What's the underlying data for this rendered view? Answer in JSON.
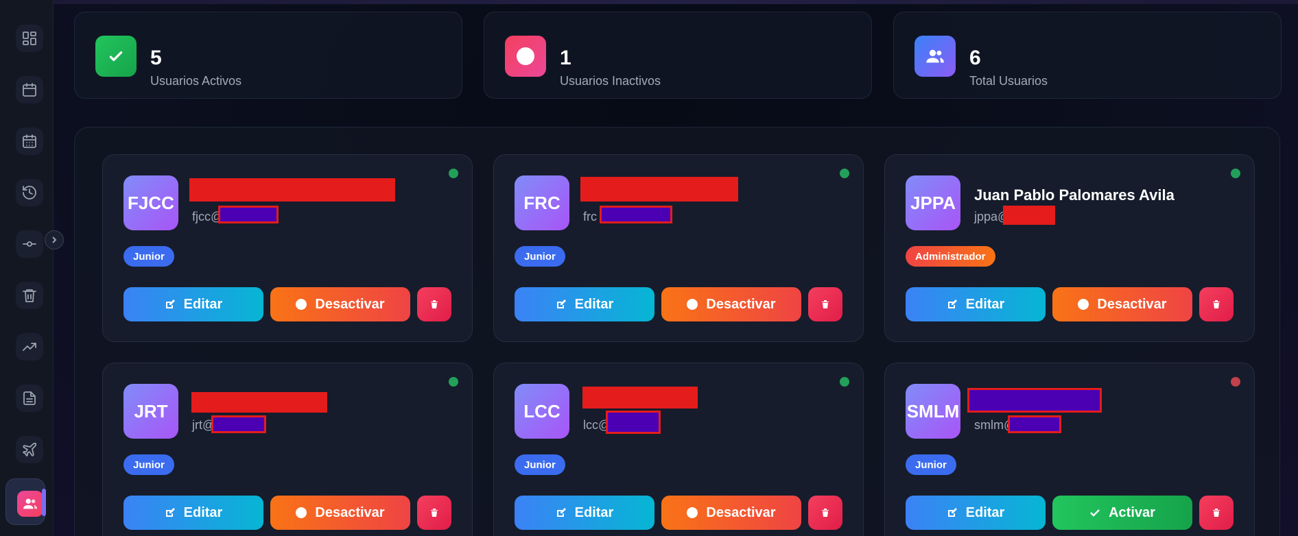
{
  "sidebar": {
    "items": [
      {
        "icon": "dashboard-icon"
      },
      {
        "icon": "calendar-icon"
      },
      {
        "icon": "calendar-grid-icon"
      },
      {
        "icon": "history-icon"
      },
      {
        "icon": "git-commit-icon"
      },
      {
        "icon": "trash-icon"
      },
      {
        "icon": "trending-up-icon"
      },
      {
        "icon": "document-icon"
      },
      {
        "icon": "plane-icon"
      }
    ],
    "active_icon": "users-icon"
  },
  "stats": [
    {
      "value": "5",
      "label": "Usuarios Activos",
      "icon": "check-icon",
      "color": "#22c55e"
    },
    {
      "value": "1",
      "label": "Usuarios Inactivos",
      "icon": "circle-icon",
      "color": "#f43f5e"
    },
    {
      "value": "6",
      "label": "Total Usuarios",
      "icon": "users-icon",
      "color": "#6366f1"
    }
  ],
  "actions": {
    "edit": "Editar",
    "deactivate": "Desactivar",
    "activate": "Activar"
  },
  "users": [
    {
      "initials": "FJCC",
      "name": "",
      "email": "fjcc@",
      "role": "Junior",
      "status": "active"
    },
    {
      "initials": "FRC",
      "name": "",
      "email": "frc",
      "role": "Junior",
      "status": "active"
    },
    {
      "initials": "JPPA",
      "name": "Juan Pablo Palomares Avila",
      "email": "jppa@",
      "role": "Administrador",
      "status": "active"
    },
    {
      "initials": "JRT",
      "name": "",
      "email": "jrt@",
      "role": "Junior",
      "status": "active"
    },
    {
      "initials": "LCC",
      "name": "",
      "email": "lcc@",
      "role": "Junior",
      "status": "active"
    },
    {
      "initials": "SMLM",
      "name": "",
      "email": "smlm@",
      "role": "Junior",
      "status": "inactive"
    }
  ],
  "colors": {
    "active_dot": "#22a05a",
    "inactive_dot": "#c2414b",
    "junior_badge": "#3b6cf0",
    "admin_badge": "#ef4444"
  }
}
